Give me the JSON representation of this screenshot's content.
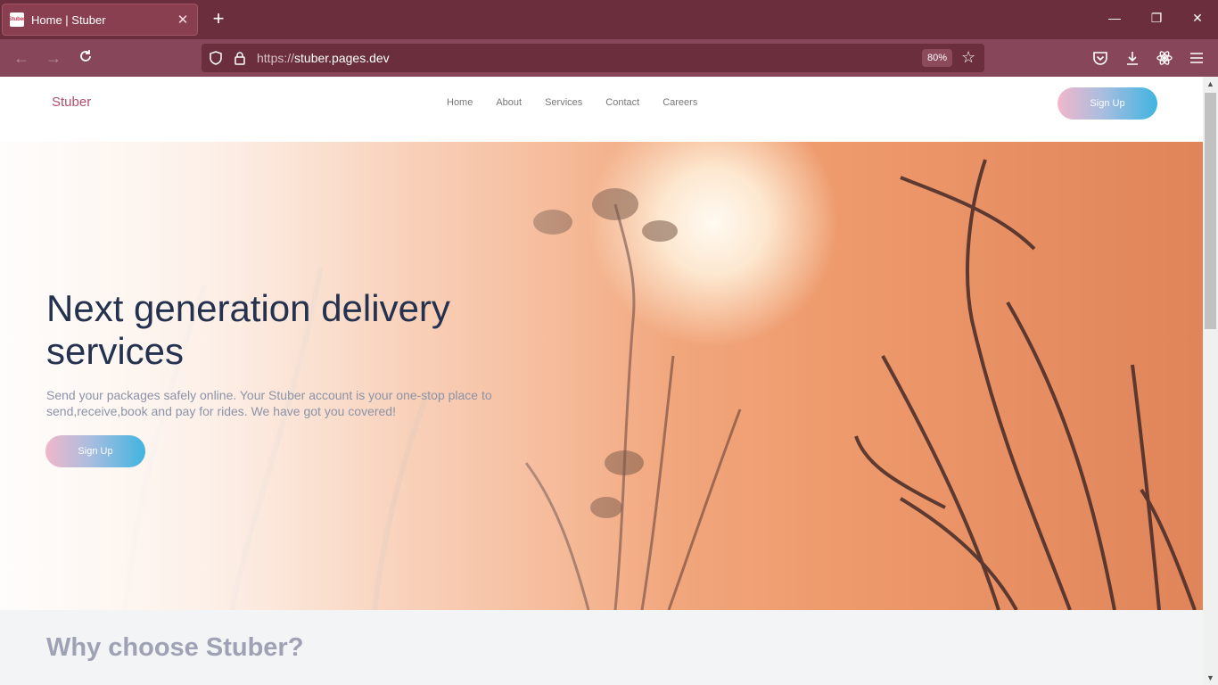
{
  "browser": {
    "tab_title": "Home | Stuber",
    "favicon_text": "Stuber",
    "new_tab_icon": "plus-icon",
    "url_protocol": "https://",
    "url_host": "stuber.pages.dev",
    "zoom": "80%",
    "icons": [
      "back-icon",
      "forward-icon",
      "reload-icon",
      "shield-icon",
      "lock-icon",
      "star-icon",
      "pocket-icon",
      "download-icon",
      "extension-icon",
      "menu-icon"
    ]
  },
  "site": {
    "logo": "Stuber",
    "nav": [
      {
        "label": "Home"
      },
      {
        "label": "About"
      },
      {
        "label": "Services"
      },
      {
        "label": "Contact"
      },
      {
        "label": "Careers"
      }
    ],
    "header_cta": "Sign Up"
  },
  "hero": {
    "title": "Next generation delivery services",
    "description": "Send your packages safely online. Your Stuber account is your one-stop place to send,receive,book and pay for rides. We have got you covered!",
    "cta": "Sign Up"
  },
  "section": {
    "title": "Why choose Stuber?"
  },
  "colors": {
    "chrome_tab_bar": "#6b2e3c",
    "chrome_nav_bar": "#874659",
    "brand": "#b14f6a",
    "heading": "#243250",
    "button_gradient_start": "#f1b7c9",
    "button_gradient_end": "#3fb5e0"
  }
}
